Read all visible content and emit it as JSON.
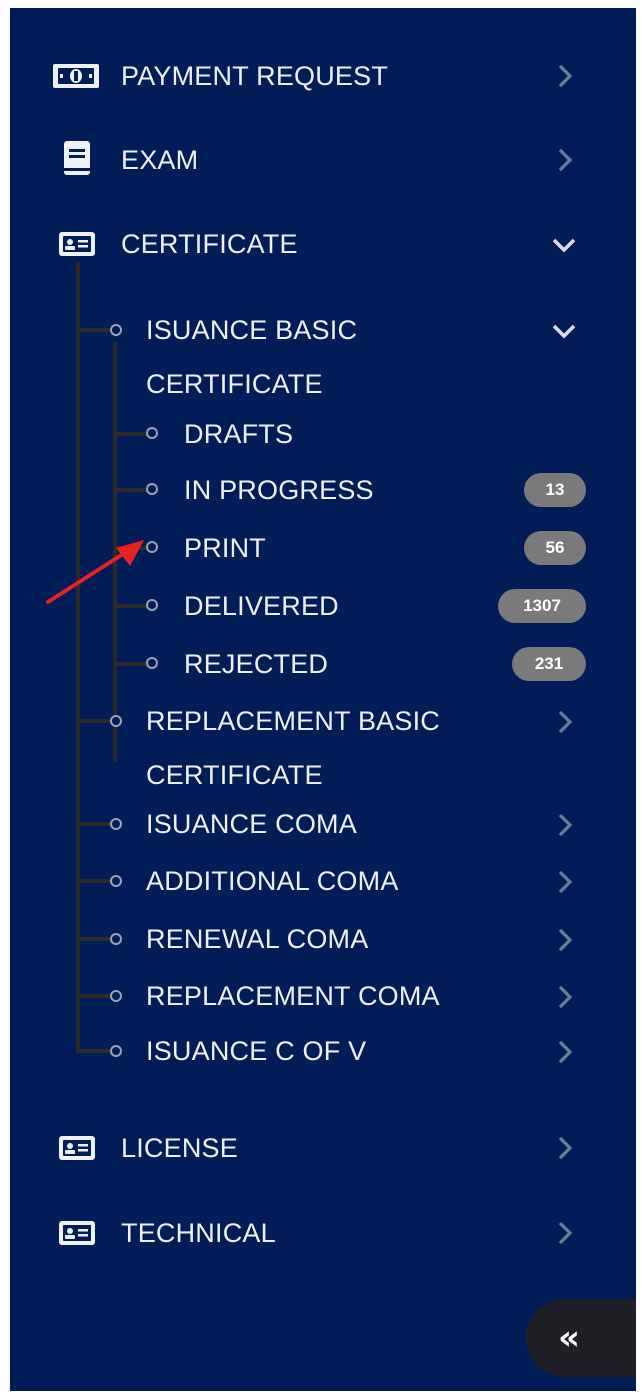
{
  "menu": {
    "payment_request": "PAYMENT REQUEST",
    "exam": "EXAM",
    "certificate": "CERTIFICATE",
    "license": "LICENSE",
    "technical": "TECHNICAL"
  },
  "certificate_children": {
    "isuance_basic": "ISUANCE BASIC CERTIFICATE",
    "replacement_basic": "REPLACEMENT BASIC CERTIFICATE",
    "isuance_coma": "ISUANCE COMA",
    "additional_coma": "ADDITIONAL COMA",
    "renewal_coma": "RENEWAL COMA",
    "replacement_coma": "REPLACEMENT COMA",
    "isuance_c_of_v": "ISUANCE C OF V"
  },
  "isuance_basic_children": [
    {
      "label": "DRAFTS",
      "badge": ""
    },
    {
      "label": "IN PROGRESS",
      "badge": "13"
    },
    {
      "label": "PRINT",
      "badge": "56"
    },
    {
      "label": "DELIVERED",
      "badge": "1307"
    },
    {
      "label": "REJECTED",
      "badge": "231"
    }
  ],
  "collapse_button": "«",
  "colors": {
    "sidebar_bg": "#001d57",
    "text": "#eef1f8",
    "badge_bg": "#7a7a7a",
    "tree_line": "#2c2b27",
    "annotation_arrow": "#e8201f"
  },
  "icons": {
    "payment_request": "money-bill-icon",
    "exam": "book-icon",
    "certificate": "id-card-icon",
    "license": "id-card-icon",
    "technical": "id-card-icon"
  }
}
